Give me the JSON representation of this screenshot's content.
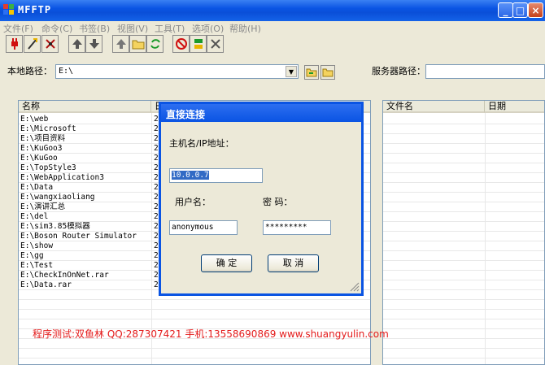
{
  "window": {
    "title": "MFFTP",
    "minimize": "_",
    "maximize": "□",
    "close": "×"
  },
  "menu": [
    "文件(F)",
    "命令(C)",
    "书签(B)",
    "视图(V)",
    "工具(T)",
    "选项(O)",
    "帮助(H)"
  ],
  "local": {
    "label": "本地路径：",
    "path": "E:\\"
  },
  "server": {
    "label": "服务器路径：",
    "path": ""
  },
  "local_list": {
    "columns": [
      "名称",
      "日"
    ],
    "rows": [
      {
        "name": "E:\\web",
        "date": "2"
      },
      {
        "name": "E:\\Microsoft",
        "date": "2"
      },
      {
        "name": "E:\\项目资料",
        "date": "2"
      },
      {
        "name": "E:\\KuGoo3",
        "date": "2"
      },
      {
        "name": "E:\\KuGoo",
        "date": "2"
      },
      {
        "name": "E:\\TopStyle3",
        "date": "2"
      },
      {
        "name": "E:\\WebApplication3",
        "date": "2"
      },
      {
        "name": "E:\\Data",
        "date": "2"
      },
      {
        "name": "E:\\wangxiaoliang",
        "date": "2"
      },
      {
        "name": "E:\\演讲汇总",
        "date": "2"
      },
      {
        "name": "E:\\del",
        "date": "2"
      },
      {
        "name": "E:\\sim3.85模拟器",
        "date": "2"
      },
      {
        "name": "E:\\Boson Router Simulator",
        "date": "2"
      },
      {
        "name": "E:\\show",
        "date": "2"
      },
      {
        "name": "E:\\gg",
        "date": "2"
      },
      {
        "name": "E:\\Test",
        "date": "2"
      },
      {
        "name": "E:\\CheckInOnNet.rar",
        "date": "2"
      },
      {
        "name": "E:\\Data.rar",
        "date": "2"
      }
    ]
  },
  "remote_list": {
    "columns": [
      "文件名",
      "日期"
    ]
  },
  "dialog": {
    "title": "直接连接",
    "host_label": "主机名/IP地址：",
    "host_value": "10.0.0.7",
    "user_label": "用户名：",
    "user_value": "anonymous",
    "pass_label": "密 码：",
    "pass_value": "*********",
    "ok_label": "确 定",
    "cancel_label": "取 消"
  },
  "footer": "程序测试:双鱼林 QQ:287307421 手机:13558690869 www.shuangyulin.com",
  "colors": {
    "titlebar": "#0a54e3",
    "footer_text": "#e41b1b"
  }
}
